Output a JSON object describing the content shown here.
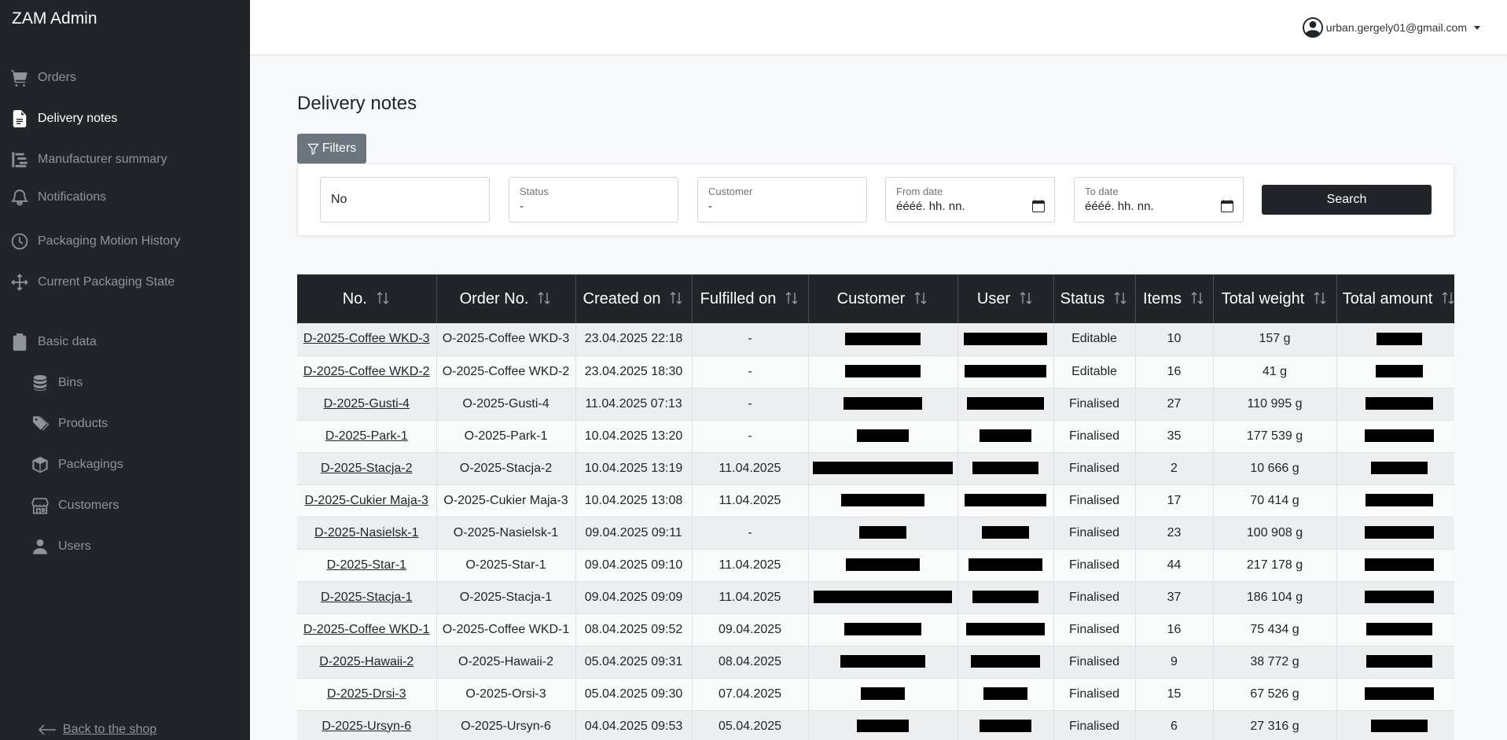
{
  "sidebar": {
    "brand": "ZAM Admin",
    "items": [
      {
        "label": "Orders",
        "icon": "cart-icon"
      },
      {
        "label": "Delivery notes",
        "icon": "document-icon",
        "active": true
      },
      {
        "label": "Manufacturer summary",
        "icon": "list-tree-icon"
      },
      {
        "label": "Notifications",
        "icon": "bell-icon"
      },
      {
        "label": "Packaging Motion History",
        "icon": "clock-icon"
      },
      {
        "label": "Current Packaging State",
        "icon": "arrows-move-icon"
      },
      {
        "label": "Basic data",
        "icon": "clipboard-icon"
      },
      {
        "label": "Bins",
        "icon": "database-icon"
      },
      {
        "label": "Products",
        "icon": "tags-icon"
      },
      {
        "label": "Packagings",
        "icon": "box-icon"
      },
      {
        "label": "Customers",
        "icon": "shop-icon"
      },
      {
        "label": "Users",
        "icon": "person-icon"
      }
    ],
    "back_link": "Back to the shop"
  },
  "topbar": {
    "user_email": "urban.gergely01@gmail.com"
  },
  "page": {
    "title": "Delivery notes",
    "filters_label": "Filters"
  },
  "filters": {
    "no_value": "No",
    "status_label": "Status",
    "status_value": "-",
    "customer_label": "Customer",
    "customer_value": "-",
    "from_label": "From date",
    "from_value": "éééé. hh. nn.",
    "to_label": "To date",
    "to_value": "éééé. hh. nn.",
    "search_label": "Search"
  },
  "table": {
    "columns": [
      "No.",
      "Order No.",
      "Created on",
      "Fulfilled on",
      "Customer",
      "User",
      "Status",
      "Items",
      "Total weight",
      "Total amount"
    ],
    "rows": [
      {
        "no": "D-2025-Coffee WKD-3",
        "order": "O-2025-Coffee WKD-3",
        "created": "23.04.2025 22:18",
        "fulfilled": "-",
        "status": "Editable",
        "items": "10",
        "weight": "157 g"
      },
      {
        "no": "D-2025-Coffee WKD-2",
        "order": "O-2025-Coffee WKD-2",
        "created": "23.04.2025 18:30",
        "fulfilled": "-",
        "status": "Editable",
        "items": "16",
        "weight": "41 g"
      },
      {
        "no": "D-2025-Gusti-4",
        "order": "O-2025-Gusti-4",
        "created": "11.04.2025 07:13",
        "fulfilled": "-",
        "status": "Finalised",
        "items": "27",
        "weight": "110 995 g"
      },
      {
        "no": "D-2025-Park-1",
        "order": "O-2025-Park-1",
        "created": "10.04.2025 13:20",
        "fulfilled": "-",
        "status": "Finalised",
        "items": "35",
        "weight": "177 539 g"
      },
      {
        "no": "D-2025-Stacja-2",
        "order": "O-2025-Stacja-2",
        "created": "10.04.2025 13:19",
        "fulfilled": "11.04.2025",
        "status": "Finalised",
        "items": "2",
        "weight": "10 666 g"
      },
      {
        "no": "D-2025-Cukier Maja-3",
        "order": "O-2025-Cukier Maja-3",
        "created": "10.04.2025 13:08",
        "fulfilled": "11.04.2025",
        "status": "Finalised",
        "items": "17",
        "weight": "70 414 g"
      },
      {
        "no": "D-2025-Nasielsk-1",
        "order": "O-2025-Nasielsk-1",
        "created": "09.04.2025 09:11",
        "fulfilled": "-",
        "status": "Finalised",
        "items": "23",
        "weight": "100 908 g"
      },
      {
        "no": "D-2025-Star-1",
        "order": "O-2025-Star-1",
        "created": "09.04.2025 09:10",
        "fulfilled": "11.04.2025",
        "status": "Finalised",
        "items": "44",
        "weight": "217 178 g"
      },
      {
        "no": "D-2025-Stacja-1",
        "order": "O-2025-Stacja-1",
        "created": "09.04.2025 09:09",
        "fulfilled": "11.04.2025",
        "status": "Finalised",
        "items": "37",
        "weight": "186 104 g"
      },
      {
        "no": "D-2025-Coffee WKD-1",
        "order": "O-2025-Coffee WKD-1",
        "created": "08.04.2025 09:52",
        "fulfilled": "09.04.2025",
        "status": "Finalised",
        "items": "16",
        "weight": "75 434 g"
      },
      {
        "no": "D-2025-Hawaii-2",
        "order": "O-2025-Hawaii-2",
        "created": "05.04.2025 09:31",
        "fulfilled": "08.04.2025",
        "status": "Finalised",
        "items": "9",
        "weight": "38 772 g"
      },
      {
        "no": "D-2025-Drsi-3",
        "order": "O-2025-Orsi-3",
        "created": "05.04.2025 09:30",
        "fulfilled": "07.04.2025",
        "status": "Finalised",
        "items": "15",
        "weight": "67 526 g"
      },
      {
        "no": "D-2025-Ursyn-6",
        "order": "O-2025-Ursyn-6",
        "created": "04.04.2025 09:53",
        "fulfilled": "05.04.2025",
        "status": "Finalised",
        "items": "6",
        "weight": "27 316 g"
      }
    ]
  }
}
